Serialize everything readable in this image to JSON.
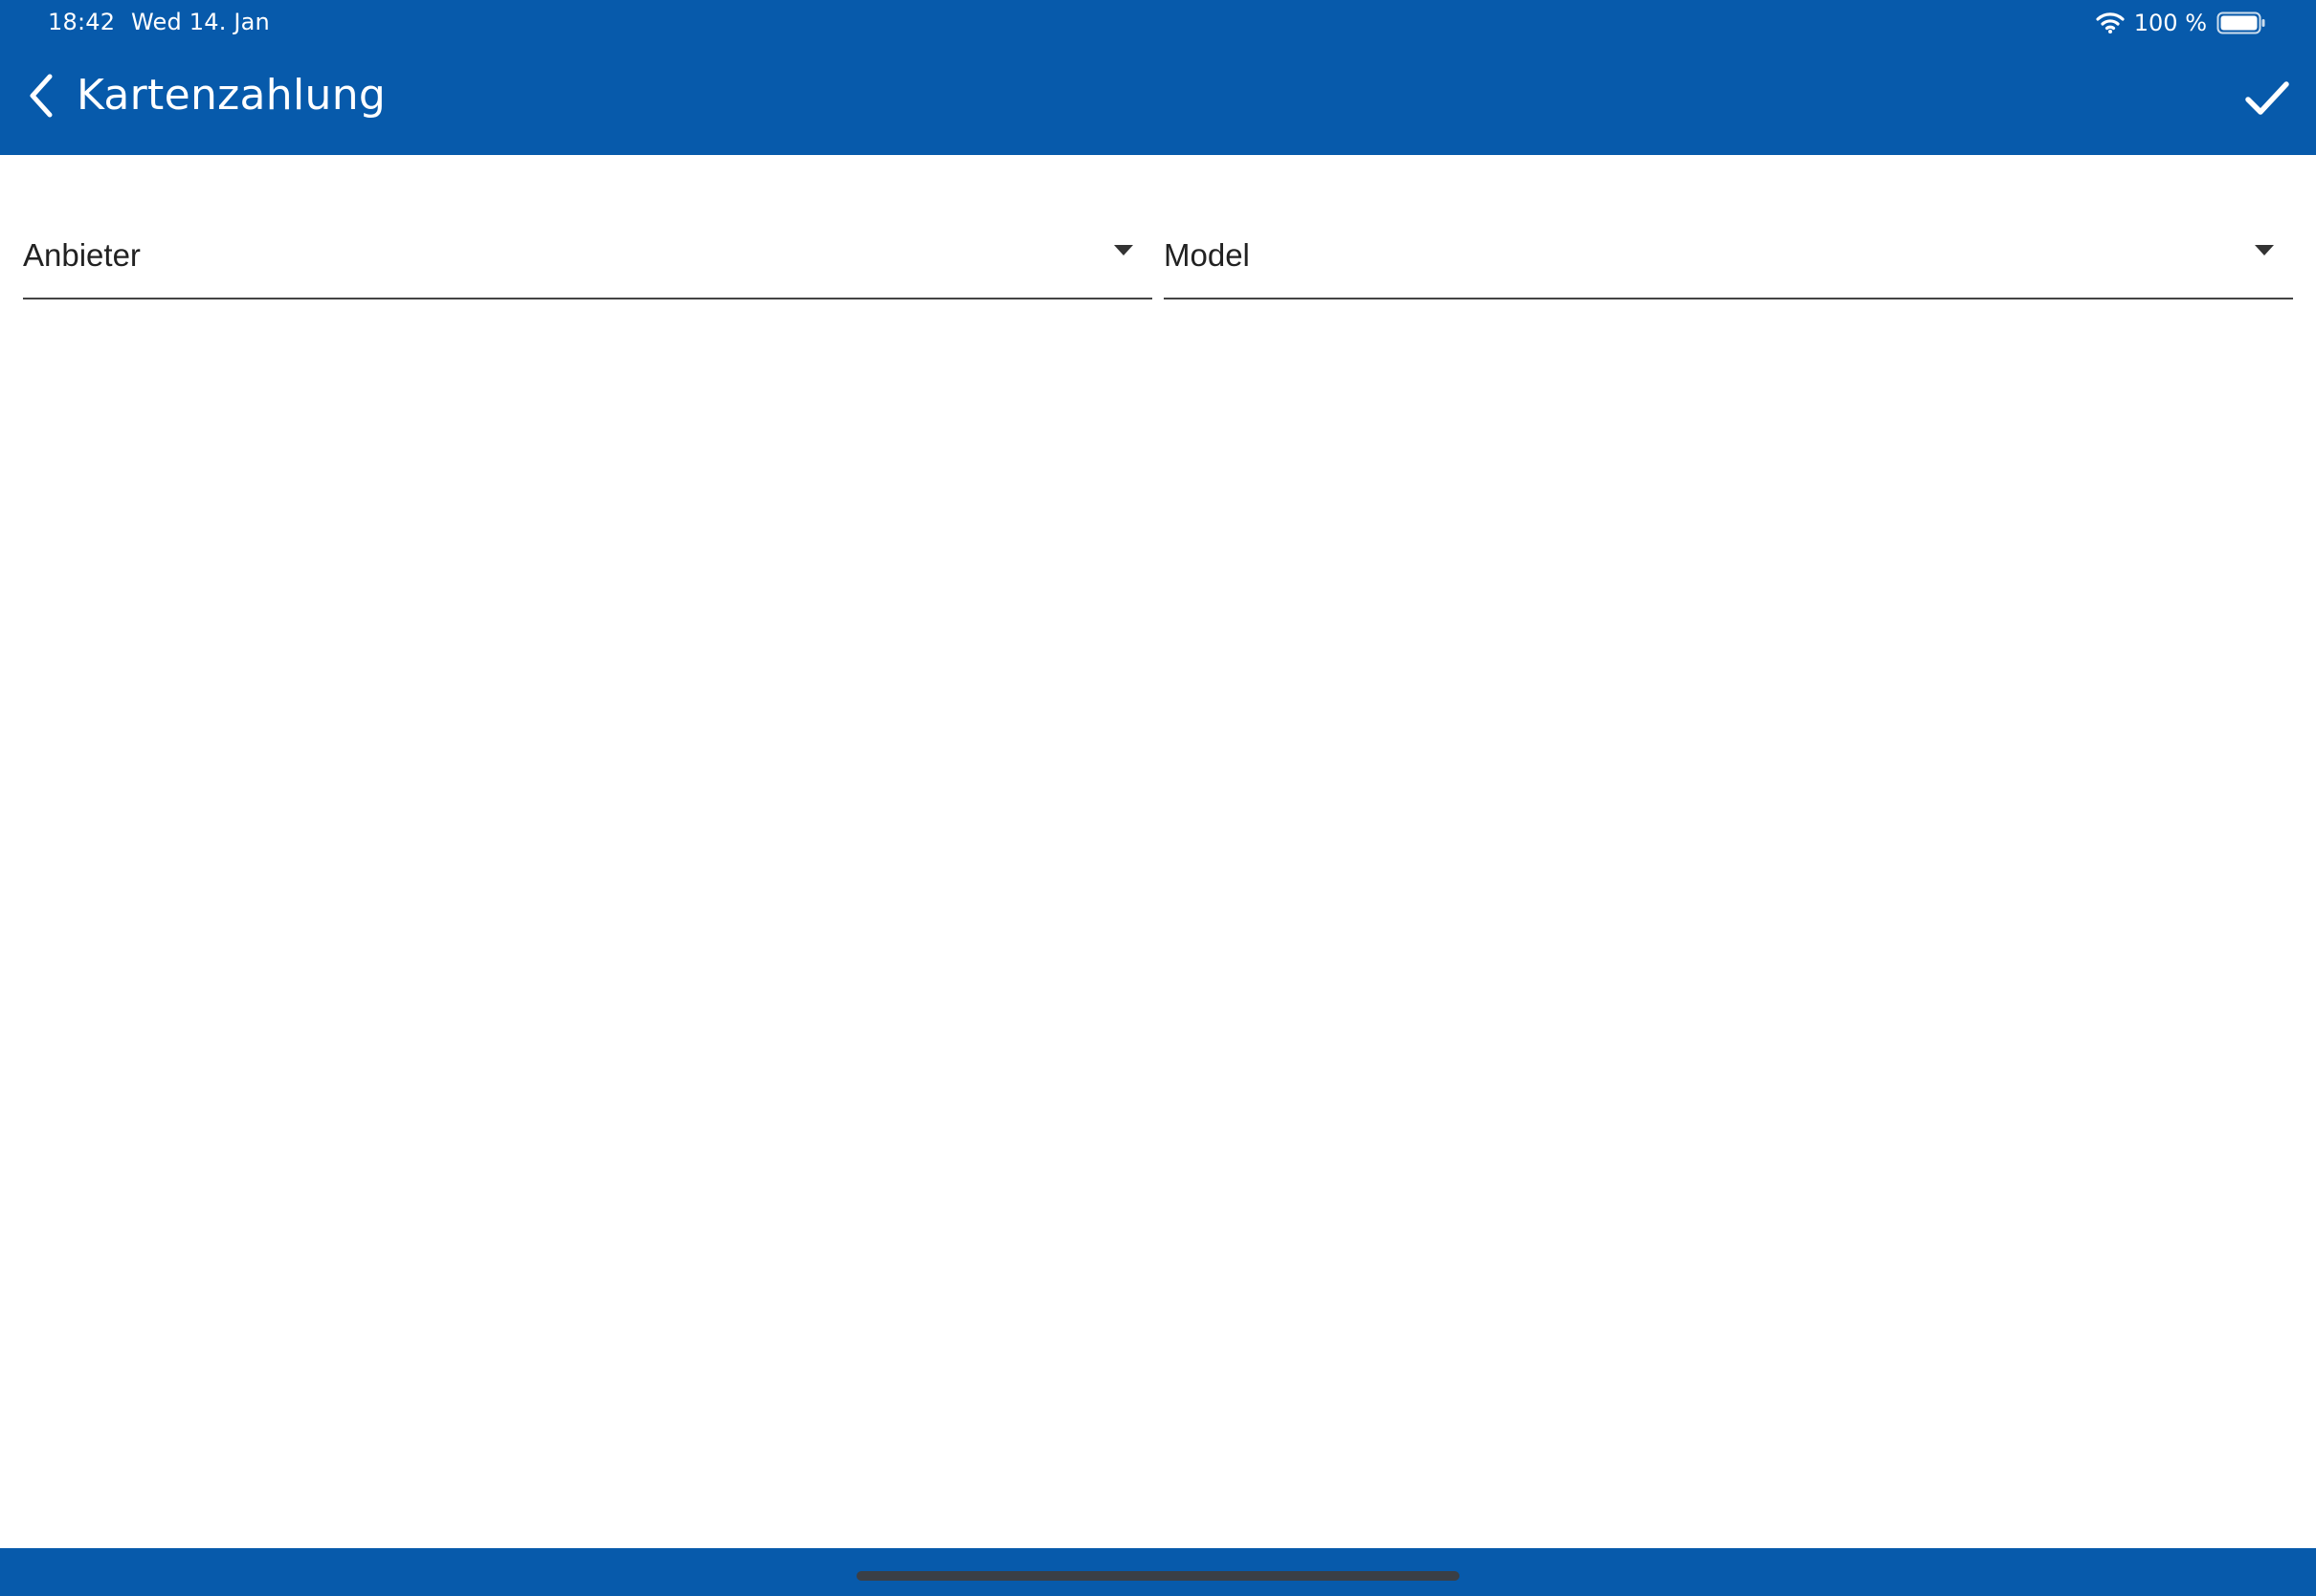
{
  "status_bar": {
    "time": "18:42",
    "date": "Wed 14. Jan",
    "battery_text": "100 %",
    "icons": [
      "wifi-icon",
      "battery-icon"
    ]
  },
  "app_bar": {
    "title": "Kartenzahlung",
    "back_icon": "chevron-left-icon",
    "confirm_icon": "check-icon",
    "color": "#075aab"
  },
  "form": {
    "provider_field": {
      "label": "Anbieter",
      "icon": "dropdown-arrow-icon"
    },
    "model_field": {
      "label": "Model",
      "icon": "dropdown-arrow-icon"
    }
  }
}
